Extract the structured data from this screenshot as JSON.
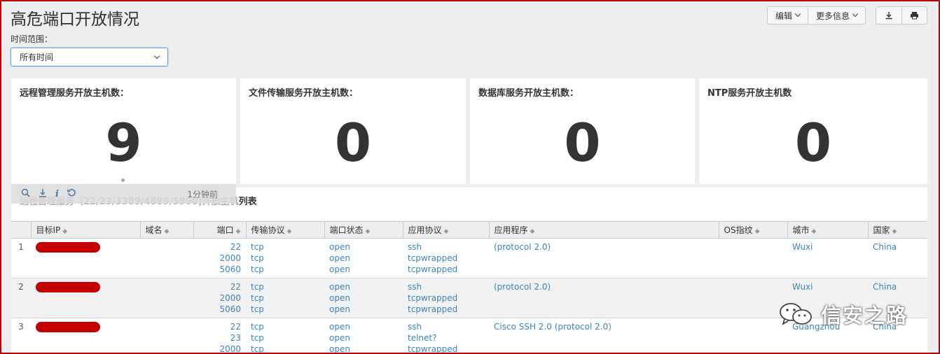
{
  "page": {
    "title": "高危端口开放情况"
  },
  "header_buttons": {
    "edit": "编辑",
    "more_info": "更多信息"
  },
  "filter": {
    "label": "时间范围：",
    "value": "所有时间"
  },
  "panels": [
    {
      "title": "远程管理服务开放主机数：",
      "value": "9"
    },
    {
      "title": "文件传输服务开放主机数：",
      "value": "0"
    },
    {
      "title": "数据库服务开放主机数：",
      "value": "0"
    },
    {
      "title": "NTP服务开放主机数",
      "value": "0"
    }
  ],
  "panel_toolbar": {
    "time_ago": "1分钟前"
  },
  "table_panel": {
    "title_hidden": "远程管理服务（22/23/3389/4899/5900)开放主机",
    "title_tail": "列表"
  },
  "table": {
    "columns": [
      "目标IP",
      "域名",
      "端口",
      "传输协议",
      "端口状态",
      "应用协议",
      "应用程序",
      "OS指纹",
      "城市",
      "国家"
    ],
    "rows": [
      {
        "n": "1",
        "domain": "",
        "ports": [
          "22",
          "2000",
          "5060"
        ],
        "proto": [
          "tcp",
          "tcp",
          "tcp"
        ],
        "state": [
          "open",
          "open",
          "open"
        ],
        "app_proto": [
          "ssh",
          "tcpwrapped",
          "tcpwrapped"
        ],
        "app": "(protocol 2.0)",
        "os": "",
        "city": "Wuxi",
        "country": "China"
      },
      {
        "n": "2",
        "domain": "",
        "ports": [
          "22",
          "2000",
          "5060"
        ],
        "proto": [
          "tcp",
          "tcp",
          "tcp"
        ],
        "state": [
          "open",
          "open",
          "open"
        ],
        "app_proto": [
          "ssh",
          "tcpwrapped",
          "tcpwrapped"
        ],
        "app": "(protocol 2.0)",
        "os": "",
        "city": "Wuxi",
        "country": "China"
      },
      {
        "n": "3",
        "domain": "",
        "ports": [
          "22",
          "23",
          "2000"
        ],
        "proto": [
          "tcp",
          "tcp",
          "tcp"
        ],
        "state": [
          "open",
          "open",
          "open"
        ],
        "app_proto": [
          "ssh",
          "telnet?",
          "tcpwrapped"
        ],
        "app": "Cisco SSH 2.0 (protocol 2.0)",
        "os": "",
        "city": "Guangzhou",
        "country": "China"
      }
    ]
  },
  "watermark": {
    "text": "信安之路"
  }
}
